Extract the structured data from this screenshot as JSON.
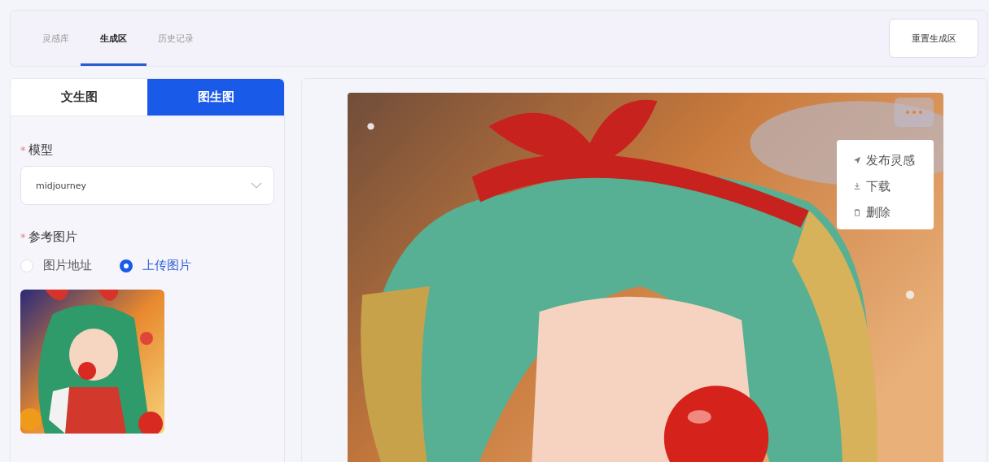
{
  "top_tabs": [
    {
      "label": "灵感库",
      "selected": false
    },
    {
      "label": "生成区",
      "selected": true
    },
    {
      "label": "历史记录",
      "selected": false
    }
  ],
  "reset_button": "重置生成区",
  "mode_tabs": [
    {
      "label": "文生图",
      "selected": false
    },
    {
      "label": "图生图",
      "selected": true
    }
  ],
  "form": {
    "model": {
      "required_mark": "*",
      "label": "模型",
      "value": "midjourney"
    },
    "reference": {
      "required_mark": "*",
      "label": "参考图片",
      "options": [
        {
          "label": "图片地址",
          "selected": false
        },
        {
          "label": "上传图片",
          "selected": true
        }
      ]
    }
  },
  "result": {
    "more_menu": {
      "expanded": true,
      "items": [
        {
          "kind": "publish",
          "label": "发布灵感"
        },
        {
          "kind": "download",
          "label": "下载"
        },
        {
          "kind": "delete",
          "label": "删除"
        }
      ]
    }
  }
}
